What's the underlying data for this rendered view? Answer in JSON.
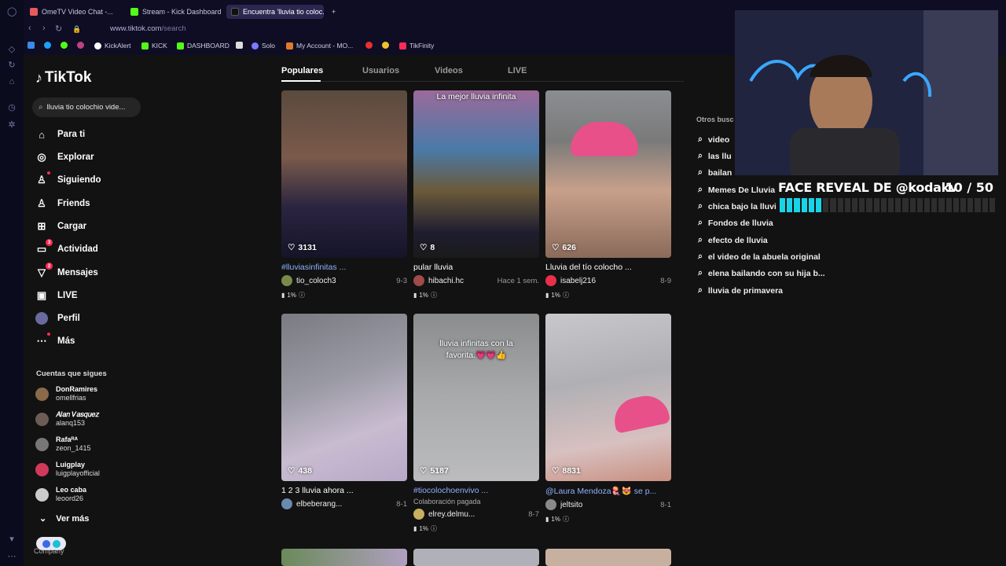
{
  "browser": {
    "tabs": [
      {
        "label": "OmeTV Video Chat -...",
        "color": "#e85a5a"
      },
      {
        "label": "Stream - Kick Dashboard",
        "color": "#53fc18"
      },
      {
        "label": "Encuentra 'lluvia tio coloc...",
        "color": "#111111"
      }
    ],
    "url_host": "www.tiktok.com",
    "url_path": "/search",
    "bookmarks": [
      {
        "label": "KickAlert",
        "color": "#53fc18"
      },
      {
        "label": "KICK",
        "color": "#53fc18"
      },
      {
        "label": "DASHBOARD",
        "color": "#53fc18"
      },
      {
        "label": "Solo",
        "color": "#7a7aff"
      },
      {
        "label": "My Account - MO...",
        "color": "#e07a2c"
      },
      {
        "label": "TikFinity",
        "color": "#fe2c55"
      }
    ]
  },
  "sidebar": {
    "logo": "TikTok",
    "search_value": "lluvia tio colochio vide...",
    "nav": [
      {
        "label": "Para ti",
        "icon": "home-icon",
        "glyph": "⌂"
      },
      {
        "label": "Explorar",
        "icon": "compass-icon",
        "glyph": "◎"
      },
      {
        "label": "Siguiendo",
        "icon": "following-icon",
        "glyph": "♙"
      },
      {
        "label": "Friends",
        "icon": "friends-icon",
        "glyph": "♙"
      },
      {
        "label": "Cargar",
        "icon": "upload-icon",
        "glyph": "⊞"
      },
      {
        "label": "Actividad",
        "icon": "activity-icon",
        "glyph": "▭",
        "badge": "3"
      },
      {
        "label": "Mensajes",
        "icon": "messages-icon",
        "glyph": "▽",
        "badge": "2"
      },
      {
        "label": "LIVE",
        "icon": "live-icon",
        "glyph": "▣"
      },
      {
        "label": "Perfil",
        "icon": "profile-avatar-icon",
        "glyph": "●"
      },
      {
        "label": "Más",
        "icon": "more-icon",
        "glyph": "⋯"
      }
    ],
    "following_title": "Cuentas que sigues",
    "following": [
      {
        "display": "DonRamires",
        "user": "omellfrias",
        "color": "#8a6a4a"
      },
      {
        "display": "𝐴𝑙𝑎𝑛 𝑉𝑎𝑠𝑞𝑢𝑒𝑧",
        "user": "alanq153",
        "color": "#6b5d55"
      },
      {
        "display": "Rafaᴿᴬ",
        "user": "zeon_1415",
        "color": "#777777"
      },
      {
        "display": "Luigplay",
        "user": "luigplayofficial",
        "color": "#d03a5a"
      },
      {
        "display": "Leo caba",
        "user": "leoord26",
        "color": "#cccccc"
      }
    ],
    "ver_mas": "Ver más",
    "company": "Company"
  },
  "tabs": [
    "Populares",
    "Usuarios",
    "Videos",
    "LIVE"
  ],
  "videos": [
    {
      "likes": "3131",
      "caption": "#lluviasinfinitas ...",
      "tag": true,
      "user": "tio_coloch3",
      "date": "9-3",
      "pct": "1%",
      "bg": "linear-gradient(180deg,#5a4a3e 0%,#7a5a4a 40%,#2a2440 70%,#151428 100%)",
      "avatar": "#7a8a4a"
    },
    {
      "likes": "8",
      "caption": "pular lluvia",
      "tag": false,
      "user": "hibachi.hc",
      "date": "Hace 1 sem.",
      "pct": "1%",
      "bg": "linear-gradient(180deg,#9b6a9a 0%,#4a7aa8 35%,#6a5a3a 60%,#1e1d30 85%,#1a1a1a 100%)",
      "avatar": "#a04a4a",
      "overlay": "La mejor lluvia infinita"
    },
    {
      "likes": "626",
      "caption": "Lluvia del tío colocho ...",
      "tag": false,
      "user": "isabelj216",
      "date": "8-9",
      "pct": "1%",
      "bg": "linear-gradient(180deg,#8a8e90 0%,#7a7a7a 30%,#c8a08a 60%,#8a6a5a 100%)",
      "avatar": "#e8304a"
    },
    {
      "likes": "438",
      "caption": "1 2 3 lluvia ahora ...",
      "tag": false,
      "user": "elbeberang...",
      "date": "8-1",
      "bg": "linear-gradient(160deg,#7a7a82 0%,#9a9aa4 40%,#c8bcd0 70%,#b8a8c8 100%)",
      "avatar": "#6a8ab0"
    },
    {
      "likes": "5187",
      "caption": "#tiocolochoenvivo ...",
      "tag": true,
      "sub": "Colaboración pagada",
      "user": "elrey.delmu...",
      "date": "8-7",
      "pct": "1%",
      "bg": "linear-gradient(180deg,#8a8c8e 0%,#a8aaac 50%,#bcbcbe 100%)",
      "avatar": "#c8b060",
      "overlay": "lluvia infinitas con la favorita.💗💗👍"
    },
    {
      "likes": "8831",
      "caption": "@Laura Mendoza🪼😻 se p...",
      "tag": true,
      "user": "jeltsito",
      "date": "8-1",
      "pct": "1%",
      "bg": "linear-gradient(170deg,#c8c8cc 0%,#b0b0b4 40%,#d8c0c0 75%,#c89080 100%)",
      "avatar": "#8a8a8a"
    }
  ],
  "others_title": "Otros busc",
  "others": [
    "video",
    "las llu",
    "bailan",
    "Memes De Lluvia",
    "chica bajo la lluvi",
    "Fondos de lluvia",
    "efecto de lluvia",
    "el video de la abuela original",
    "elena bailando con su hija b...",
    "lluvia de primavera"
  ],
  "overlay": {
    "title": "FACE REVEAL DE @kodakv",
    "count": "10 / 50",
    "progress_fraction": 0.2,
    "progress_color": "#19d4e6"
  }
}
